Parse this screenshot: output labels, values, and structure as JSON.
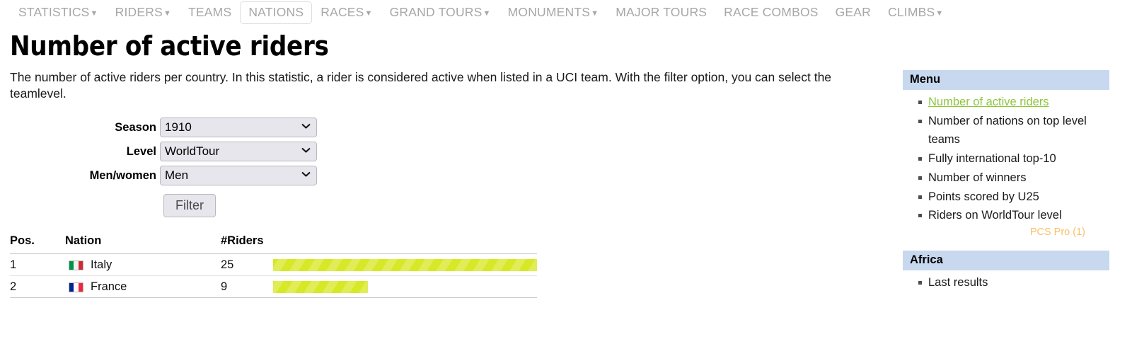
{
  "nav": {
    "items": [
      {
        "label": "STATISTICS",
        "caret": true,
        "active": false
      },
      {
        "label": "RIDERS",
        "caret": true,
        "active": false
      },
      {
        "label": "TEAMS",
        "caret": false,
        "active": false
      },
      {
        "label": "NATIONS",
        "caret": false,
        "active": true
      },
      {
        "label": "RACES",
        "caret": true,
        "active": false
      },
      {
        "label": "GRAND TOURS",
        "caret": true,
        "active": false
      },
      {
        "label": "MONUMENTS",
        "caret": true,
        "active": false
      },
      {
        "label": "MAJOR TOURS",
        "caret": false,
        "active": false
      },
      {
        "label": "RACE COMBOS",
        "caret": false,
        "active": false
      },
      {
        "label": "GEAR",
        "caret": false,
        "active": false
      },
      {
        "label": "CLIMBS",
        "caret": true,
        "active": false
      }
    ],
    "caret_glyph": "▼"
  },
  "page": {
    "title": "Number of active riders",
    "intro": "The number of active riders per country. In this statistic, a rider is considered active when listed in a UCI team. With the filter option, you can select the teamlevel."
  },
  "filter": {
    "season": {
      "label": "Season",
      "value": "1910",
      "options": [
        "1910"
      ]
    },
    "level": {
      "label": "Level",
      "value": "WorldTour",
      "options": [
        "WorldTour"
      ]
    },
    "gender": {
      "label": "Men/women",
      "value": "Men",
      "options": [
        "Men"
      ]
    },
    "submit_label": "Filter",
    "dropdown_glyph": "⌄"
  },
  "table": {
    "columns": [
      "Pos.",
      "Nation",
      "#Riders",
      ""
    ],
    "rows": [
      {
        "pos": "1",
        "nation": "Italy",
        "riders": "25",
        "bar_pct": 100,
        "flag": {
          "name": "flag-italy",
          "colors": [
            "#009246",
            "#f1f2f1",
            "#ce2b37"
          ]
        }
      },
      {
        "pos": "2",
        "nation": "France",
        "riders": "9",
        "bar_pct": 36,
        "flag": {
          "name": "flag-france",
          "colors": [
            "#002395",
            "#ffffff",
            "#ed2939"
          ]
        }
      }
    ]
  },
  "sidebar": {
    "panels": [
      {
        "title": "Menu",
        "items": [
          {
            "label": "Number of active riders",
            "active": true
          },
          {
            "label": "Number of nations on top level teams",
            "active": false
          },
          {
            "label": "Fully international top-10",
            "active": false
          },
          {
            "label": "Number of winners",
            "active": false
          },
          {
            "label": "Points scored by U25",
            "active": false
          },
          {
            "label": "Riders on WorldTour level",
            "active": false
          }
        ],
        "footnote": "PCS Pro (1)"
      },
      {
        "title": "Africa",
        "items": [
          {
            "label": "Last results",
            "active": false
          }
        ],
        "footnote": ""
      }
    ]
  },
  "chart_data": {
    "type": "bar",
    "title": "Number of active riders",
    "categories": [
      "Italy",
      "France"
    ],
    "values": [
      25,
      9
    ],
    "xlabel": "#Riders",
    "ylabel": "Nation",
    "xlim": [
      0,
      25
    ],
    "grid": false,
    "legend": "none",
    "bar_color": "#d7e827"
  }
}
